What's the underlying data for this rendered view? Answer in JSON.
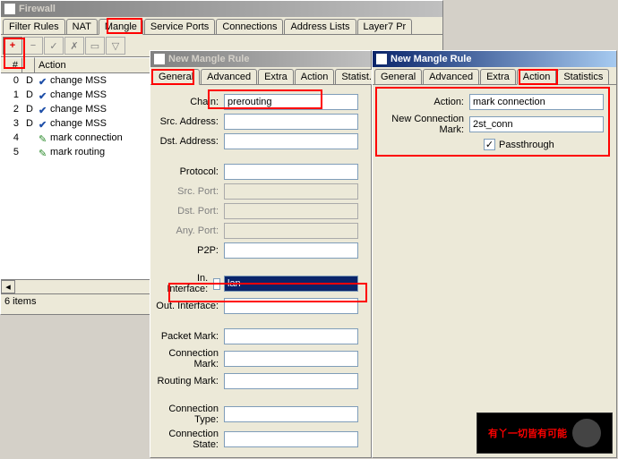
{
  "firewall": {
    "title": "Firewall",
    "tabs": [
      "Filter Rules",
      "NAT",
      "Mangle",
      "Service Ports",
      "Connections",
      "Address Lists",
      "Layer7 Pr"
    ],
    "active_tab": "Mangle",
    "columns": [
      "#",
      "",
      "Action"
    ],
    "rows": [
      {
        "n": "0",
        "f": "D",
        "icon": "check",
        "label": "change MSS"
      },
      {
        "n": "1",
        "f": "D",
        "icon": "check",
        "label": "change MSS"
      },
      {
        "n": "2",
        "f": "D",
        "icon": "check",
        "label": "change MSS"
      },
      {
        "n": "3",
        "f": "D",
        "icon": "check",
        "label": "change MSS"
      },
      {
        "n": "4",
        "f": "",
        "icon": "pencil",
        "label": "mark connection"
      },
      {
        "n": "5",
        "f": "",
        "icon": "pencil",
        "label": "mark routing"
      }
    ],
    "status": "6 items"
  },
  "rule_general": {
    "title": "New Mangle Rule",
    "tabs": [
      "General",
      "Advanced",
      "Extra",
      "Action",
      "Statist..."
    ],
    "active_tab": "General",
    "fields": {
      "chain_label": "Chain:",
      "chain": "prerouting",
      "src_label": "Src. Address:",
      "dst_label": "Dst. Address:",
      "proto_label": "Protocol:",
      "srcport_label": "Src. Port:",
      "dstport_label": "Dst. Port:",
      "anyport_label": "Any. Port:",
      "p2p_label": "P2P:",
      "inif_label": "In. Interface:",
      "inif": "lan",
      "outif_label": "Out. Interface:",
      "pmark_label": "Packet Mark:",
      "cmark_label": "Connection Mark:",
      "rmark_label": "Routing Mark:",
      "ctype_label": "Connection Type:",
      "cstate_label": "Connection State:"
    }
  },
  "rule_action": {
    "title": "New Mangle Rule",
    "tabs": [
      "General",
      "Advanced",
      "Extra",
      "Action",
      "Statistics"
    ],
    "active_tab": "Action",
    "fields": {
      "action_label": "Action:",
      "action": "mark connection",
      "ncm_label": "New Connection Mark:",
      "ncm": "2st_conn",
      "pass_label": "Passthrough",
      "pass_checked": true
    }
  },
  "watermark": "有丫一切皆有可能"
}
